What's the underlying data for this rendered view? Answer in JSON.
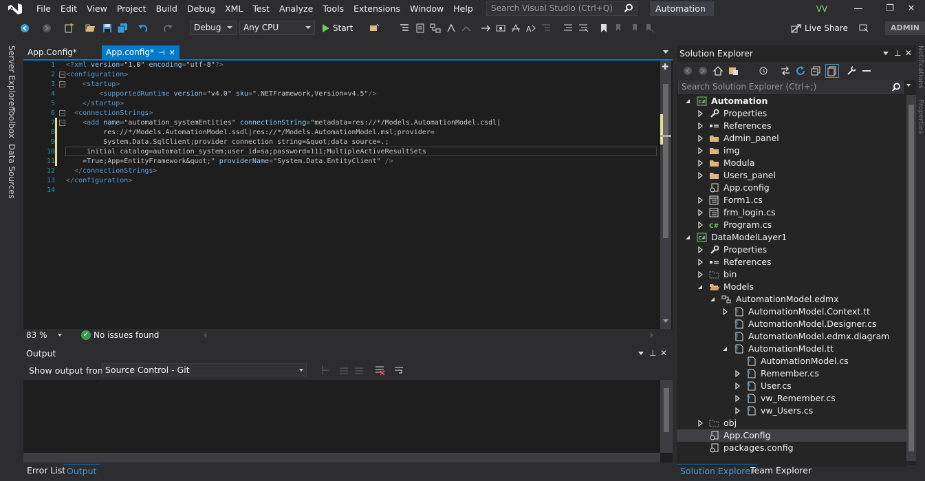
{
  "menubar": {
    "items": [
      "File",
      "Edit",
      "View",
      "Project",
      "Build",
      "Debug",
      "XML",
      "Test",
      "Analyze",
      "Tools",
      "Extensions",
      "Window",
      "Help"
    ],
    "search_placeholder": "Search Visual Studio (Ctrl+Q)",
    "solution_name": "Automation",
    "user_initials": "VV",
    "minimize": "—",
    "restore": "❐",
    "close": "✕"
  },
  "toolbar": {
    "configuration": "Debug",
    "platform": "Any CPU",
    "start_label": "Start",
    "live_share_label": "Live Share",
    "admin_label": "ADMIN"
  },
  "side_tabs": {
    "left": [
      "Server Explorer",
      "Toolbox",
      "Data Sources"
    ],
    "right": [
      "Notifications",
      "Properties"
    ]
  },
  "document_tabs": [
    {
      "label": "App.Config*",
      "active": false
    },
    {
      "label": "App.config*",
      "active": true
    }
  ],
  "editor": {
    "lines": [
      {
        "num": "1",
        "tokens": [
          [
            "p",
            "<?"
          ],
          [
            "t",
            "xml"
          ],
          [
            "a",
            " version"
          ],
          [
            "p",
            "="
          ],
          [
            "v",
            "\"1.0\""
          ],
          [
            "a",
            " encoding"
          ],
          [
            "p",
            "="
          ],
          [
            "v",
            "\"utf-8\""
          ],
          [
            "p",
            "?>"
          ]
        ]
      },
      {
        "num": "2",
        "tokens": [
          [
            "p",
            "<"
          ],
          [
            "t",
            "configuration"
          ],
          [
            "p",
            ">"
          ]
        ]
      },
      {
        "num": "3",
        "tokens": [
          [
            "p",
            "    <"
          ],
          [
            "t",
            "startup"
          ],
          [
            "p",
            ">"
          ]
        ]
      },
      {
        "num": "4",
        "tokens": [
          [
            "p",
            "        <"
          ],
          [
            "t",
            "supportedRuntime"
          ],
          [
            "a",
            " version"
          ],
          [
            "p",
            "="
          ],
          [
            "v",
            "\"v4.0\""
          ],
          [
            "a",
            " sku"
          ],
          [
            "p",
            "="
          ],
          [
            "v",
            "\".NETFramework,Version=v4.5\""
          ],
          [
            "p",
            "/>"
          ]
        ]
      },
      {
        "num": "5",
        "tokens": [
          [
            "p",
            "    </"
          ],
          [
            "t",
            "startup"
          ],
          [
            "p",
            ">"
          ]
        ]
      },
      {
        "num": "6",
        "tokens": [
          [
            "p",
            "  <"
          ],
          [
            "t",
            "connectionStrings"
          ],
          [
            "p",
            ">"
          ]
        ]
      },
      {
        "num": "7",
        "tokens": [
          [
            "p",
            "    <"
          ],
          [
            "t",
            "add"
          ],
          [
            "a",
            " name"
          ],
          [
            "p",
            "="
          ],
          [
            "v",
            "\"automation_systemEntities\""
          ],
          [
            "a",
            " connectionString"
          ],
          [
            "p",
            "="
          ],
          [
            "v",
            "\"metadata=res://*/Models.AutomationModel.csdl|"
          ]
        ]
      },
      {
        "num": "8",
        "tokens": [
          [
            "v",
            "         res://*/Models.AutomationModel.ssdl|res://*/Models.AutomationModel.msl;provider="
          ]
        ]
      },
      {
        "num": "9",
        "tokens": [
          [
            "v",
            "         System.Data.SqlClient;provider connection string=&quot;data source=.;"
          ]
        ]
      },
      {
        "num": "10",
        "tokens": [
          [
            "v",
            "     initial catalog=automation_system;user id=sa;password=111;MultipleActiveResultSets"
          ]
        ]
      },
      {
        "num": "11",
        "tokens": [
          [
            "v",
            "    =True;App=EntityFramework&quot;\""
          ],
          [
            "a",
            " providerName"
          ],
          [
            "p",
            "="
          ],
          [
            "v",
            "\"System.Data.EntityClient\""
          ],
          [
            "p",
            " />"
          ]
        ]
      },
      {
        "num": "12",
        "tokens": [
          [
            "p",
            "  </"
          ],
          [
            "t",
            "connectionStrings"
          ],
          [
            "p",
            ">"
          ]
        ]
      },
      {
        "num": "13",
        "tokens": [
          [
            "p",
            "</"
          ],
          [
            "t",
            "configuration"
          ],
          [
            "p",
            ">"
          ]
        ]
      },
      {
        "num": "14",
        "tokens": []
      }
    ]
  },
  "editor_status": {
    "zoom": "83 %",
    "issues": "No issues found"
  },
  "output": {
    "title": "Output",
    "show_from_label": "Show output from:",
    "source": "Source Control - Git"
  },
  "bottom_tabs": [
    "Error List",
    "Output"
  ],
  "solution_explorer": {
    "title": "Solution Explorer",
    "search_placeholder": "Search Solution Explorer (Ctrl+;)",
    "tree": [
      {
        "label": "Automation",
        "depth": 0,
        "expander": "open",
        "icon": "csproj",
        "bold": true
      },
      {
        "label": "Properties",
        "depth": 1,
        "expander": "closed",
        "icon": "wrench"
      },
      {
        "label": "References",
        "depth": 1,
        "expander": "closed",
        "icon": "refs"
      },
      {
        "label": "Admin_panel",
        "depth": 1,
        "expander": "closed",
        "icon": "folder"
      },
      {
        "label": "img",
        "depth": 1,
        "expander": "closed",
        "icon": "folder"
      },
      {
        "label": "Modula",
        "depth": 1,
        "expander": "closed",
        "icon": "folder"
      },
      {
        "label": "Users_panel",
        "depth": 1,
        "expander": "closed",
        "icon": "folder"
      },
      {
        "label": "App.config",
        "depth": 1,
        "expander": "none",
        "icon": "config"
      },
      {
        "label": "Form1.cs",
        "depth": 1,
        "expander": "closed",
        "icon": "form"
      },
      {
        "label": "frm_login.cs",
        "depth": 1,
        "expander": "closed",
        "icon": "form"
      },
      {
        "label": "Program.cs",
        "depth": 1,
        "expander": "closed",
        "icon": "cs"
      },
      {
        "label": "DataModelLayer1",
        "depth": 0,
        "expander": "open",
        "icon": "csproj"
      },
      {
        "label": "Properties",
        "depth": 1,
        "expander": "closed",
        "icon": "wrench"
      },
      {
        "label": "References",
        "depth": 1,
        "expander": "closed",
        "icon": "refs"
      },
      {
        "label": "bin",
        "depth": 1,
        "expander": "closed",
        "icon": "folder-dashed"
      },
      {
        "label": "Models",
        "depth": 1,
        "expander": "open",
        "icon": "folder-open"
      },
      {
        "label": "AutomationModel.edmx",
        "depth": 2,
        "expander": "open",
        "icon": "edmx"
      },
      {
        "label": "AutomationModel.Context.tt",
        "depth": 3,
        "expander": "closed",
        "icon": "tt"
      },
      {
        "label": "AutomationModel.Designer.cs",
        "depth": 3,
        "expander": "none",
        "icon": "tt"
      },
      {
        "label": "AutomationModel.edmx.diagram",
        "depth": 3,
        "expander": "none",
        "icon": "tt"
      },
      {
        "label": "AutomationModel.tt",
        "depth": 3,
        "expander": "open",
        "icon": "tt"
      },
      {
        "label": "AutomationModel.cs",
        "depth": 4,
        "expander": "none",
        "icon": "tt"
      },
      {
        "label": "Remember.cs",
        "depth": 4,
        "expander": "closed",
        "icon": "tt"
      },
      {
        "label": "User.cs",
        "depth": 4,
        "expander": "closed",
        "icon": "tt"
      },
      {
        "label": "vw_Remember.cs",
        "depth": 4,
        "expander": "closed",
        "icon": "tt"
      },
      {
        "label": "vw_Users.cs",
        "depth": 4,
        "expander": "closed",
        "icon": "tt"
      },
      {
        "label": "obj",
        "depth": 1,
        "expander": "closed",
        "icon": "folder-dashed"
      },
      {
        "label": "App.Config",
        "depth": 1,
        "expander": "none",
        "icon": "config",
        "selected": true
      },
      {
        "label": "packages.config",
        "depth": 1,
        "expander": "none",
        "icon": "config"
      }
    ],
    "bottom_tabs": [
      "Solution Explorer",
      "Team Explorer"
    ]
  },
  "colors": {
    "accent": "#007acc",
    "editor_bg": "#1e1e1e",
    "chrome_bg": "#2d2d30",
    "tag": "#569cd6",
    "attribute": "#92caf4",
    "line_number": "#2b91af"
  }
}
